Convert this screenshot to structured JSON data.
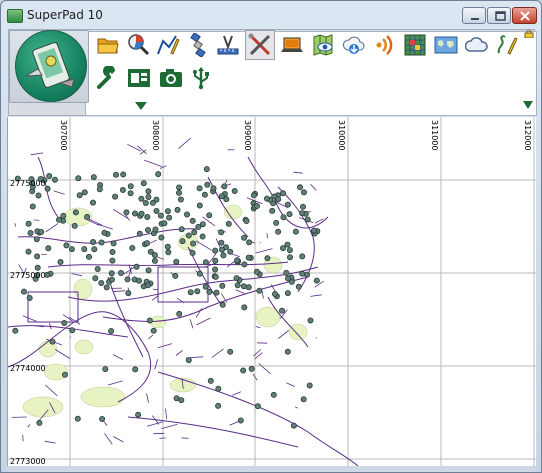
{
  "window": {
    "title": "SuperPad 10"
  },
  "toolbar": {
    "row1": [
      {
        "name": "open-folder-icon",
        "label": "Open"
      },
      {
        "name": "layer-query-icon",
        "label": "Query"
      },
      {
        "name": "draw-line-icon",
        "label": "Draw"
      },
      {
        "name": "satellite-icon",
        "label": "GPS"
      },
      {
        "name": "survey-ruler-icon",
        "label": "Measure"
      },
      {
        "name": "tools-cross-icon",
        "label": "Tools"
      },
      {
        "name": "laptop-icon",
        "label": "Connect"
      },
      {
        "name": "map-eye-icon",
        "label": "View"
      },
      {
        "name": "cloud-download-icon",
        "label": "Download"
      },
      {
        "name": "wireless-signal-icon",
        "label": "Signal"
      },
      {
        "name": "grid-map-icon",
        "label": "Grid"
      },
      {
        "name": "world-map-icon",
        "label": "Basemap"
      },
      {
        "name": "cloud-icon",
        "label": "Cloud"
      },
      {
        "name": "edit-pen-icon",
        "label": "Edit"
      }
    ],
    "row2": [
      {
        "name": "wrench-icon",
        "label": "Settings"
      },
      {
        "name": "form-panel-icon",
        "label": "Form"
      },
      {
        "name": "camera-icon",
        "label": "Camera"
      },
      {
        "name": "usb-icon",
        "label": "USB"
      }
    ]
  },
  "map": {
    "x_ticks": [
      "307000",
      "308000",
      "309000",
      "310000",
      "311000",
      "312000"
    ],
    "y_ticks": [
      "2775000",
      "2775000",
      "2774000",
      "2773000"
    ],
    "colors": {
      "roads": "#5b2a86",
      "points_fill": "#5f7f78",
      "points_stroke": "#2c3d38",
      "polygons": "#e8f3c4",
      "grid": "#b9b9b9"
    }
  }
}
